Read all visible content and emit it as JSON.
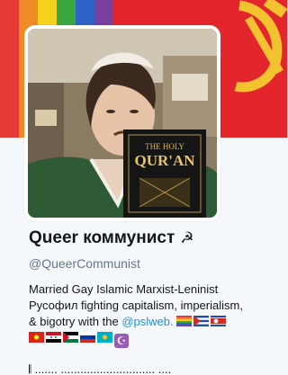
{
  "header": {
    "rainbow_colors": [
      "#e53935",
      "#f08a24",
      "#f5d21e",
      "#3aa63f",
      "#2f63c8",
      "#7b3fa0"
    ],
    "flag_color": "#e2262c",
    "emblem_color": "#f2c230"
  },
  "profile": {
    "display_name": "Queer коммунист",
    "name_symbol": "☭",
    "handle": "@QueerCommunist",
    "bio_line1": "Married Gay Islamic Marxist-Leninist",
    "bio_line2": "Русофил fighting capitalism, imperialism,",
    "bio_line3_prefix": "& bigotry with the",
    "bio_mention": "@pslweb.",
    "crescent_symbol": "☪",
    "bio_cutoff": "𝄃 ....... ............................. ...."
  },
  "avatar": {
    "book_title_top": "THE HOLY",
    "book_title_main": "QUR'AN"
  },
  "colors": {
    "accent": "#1b95e0",
    "text": "#14171a",
    "secondary": "#657786"
  }
}
